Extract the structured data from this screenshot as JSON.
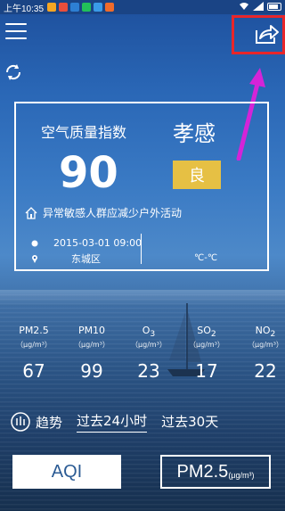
{
  "status_bar": {
    "time": "上午10:35",
    "app_colors": [
      "#f5a623",
      "#e94e3c",
      "#2d7fd3",
      "#22c05a",
      "#3a9be8",
      "#f06b2a"
    ]
  },
  "card": {
    "title": "空气质量指数",
    "aqi": "90",
    "city": "孝感",
    "level": "良",
    "level_color": "#e6c044",
    "advice": "异常敏感人群应减少户外活动",
    "datetime": "2015-03-01 09:00",
    "district": "东城区",
    "temperature": "℃-℃"
  },
  "pollutants": [
    {
      "name": "PM2.5",
      "sub": "",
      "unit": "（μg/m³）",
      "value": "67"
    },
    {
      "name": "PM10",
      "sub": "",
      "unit": "（μg/m³）",
      "value": "99"
    },
    {
      "name": "O",
      "sub": "3",
      "unit": "（μg/m³）",
      "value": "23"
    },
    {
      "name": "SO",
      "sub": "2",
      "unit": "（μg/m³）",
      "value": "17"
    },
    {
      "name": "NO",
      "sub": "2",
      "unit": "（μg/m³）",
      "value": "22"
    }
  ],
  "trend": {
    "label": "趋势",
    "tabs": [
      "过去24小时",
      "过去30天"
    ]
  },
  "buttons": {
    "aqi": "AQI",
    "pm_main": "PM2.5",
    "pm_unit": "(μg/m³)"
  },
  "annotation": {
    "box_color": "#e8262a",
    "arrow_color": "#d424d8"
  }
}
